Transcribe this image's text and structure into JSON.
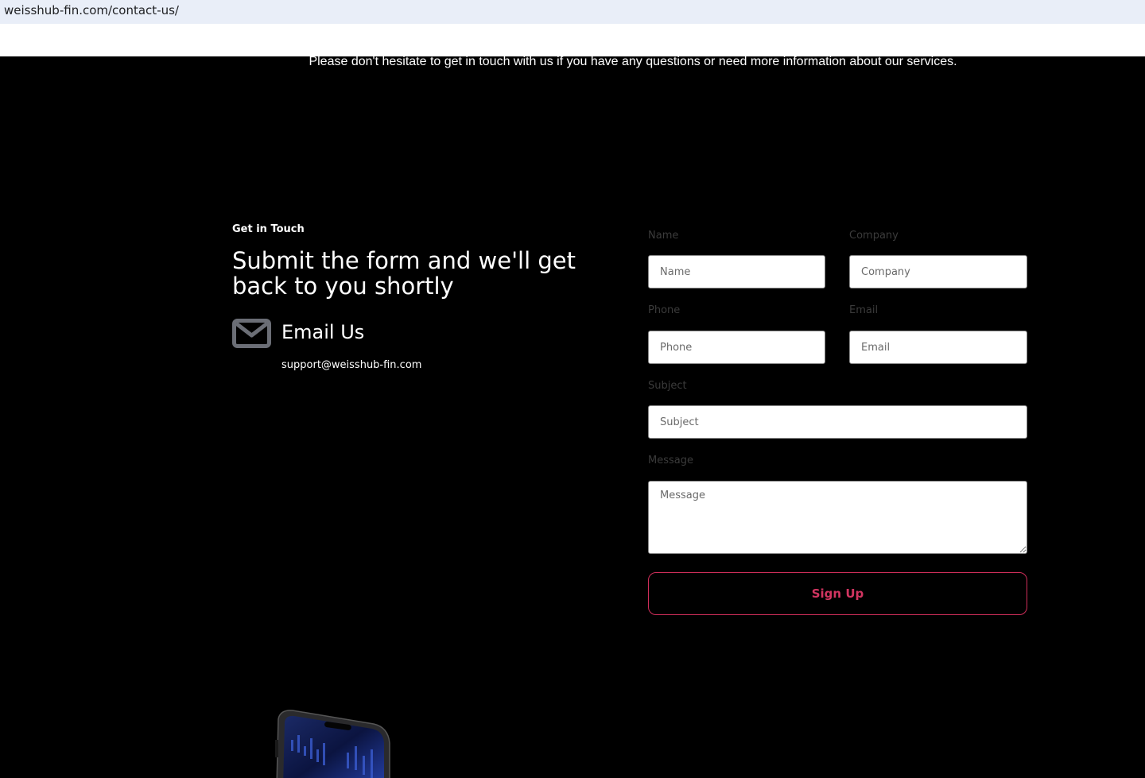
{
  "browser": {
    "url": "weisshub-fin.com/contact-us/"
  },
  "intro": {
    "text": "Please don't hesitate to get in touch with us if you have any questions or need more information about our services."
  },
  "contact": {
    "eyebrow": "Get in Touch",
    "headline": "Submit the form and we'll get back to you shortly",
    "email_title": "Email Us",
    "email_address": "support@weisshub-fin.com"
  },
  "form": {
    "name": {
      "label": "Name",
      "placeholder": "Name",
      "value": ""
    },
    "company": {
      "label": "Company",
      "placeholder": "Company",
      "value": ""
    },
    "phone": {
      "label": "Phone",
      "placeholder": "Phone",
      "value": ""
    },
    "email": {
      "label": "Email",
      "placeholder": "Email",
      "value": ""
    },
    "subject": {
      "label": "Subject",
      "placeholder": "Subject",
      "value": ""
    },
    "message": {
      "label": "Message",
      "placeholder": "Message",
      "value": ""
    },
    "submit_label": "Sign Up"
  },
  "colors": {
    "accent": "#d23561",
    "background": "#000000",
    "icon_gray": "#6b6e76"
  },
  "icons": {
    "email": "envelope-icon",
    "device": "smartphone-image"
  }
}
